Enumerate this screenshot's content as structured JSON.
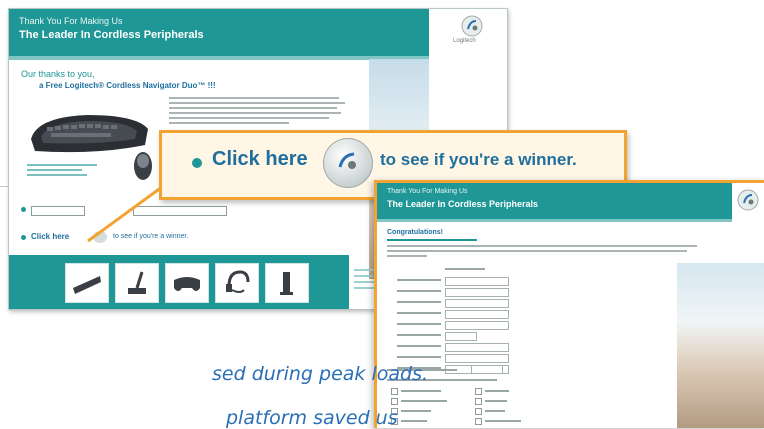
{
  "screen_a": {
    "header_small": "Thank You For Making Us",
    "header_big": "The Leader In Cordless Peripherals",
    "logo_text": "Logitech",
    "title_line1": "Our thanks to you,",
    "title_line2": "a Free Logitech® Cordless Navigator Duo™ !!!",
    "row_click_here": "Click here",
    "row_see": "to see if you're a winner."
  },
  "callout": {
    "click_here": "Click here",
    "see_winner": "to see if you're a winner."
  },
  "screen_b": {
    "header_small": "Thank You For Making Us",
    "header_big": "The Leader In Cordless Peripherals",
    "congratulations": "Congratulations!"
  },
  "quote": {
    "line1": "sed during peak loads.",
    "line2": "platform saved us"
  },
  "colors": {
    "teal": "#1f9796",
    "orange": "#f3a331",
    "blue_text": "#1f6f9e",
    "quote_blue": "#2a6fb5"
  }
}
